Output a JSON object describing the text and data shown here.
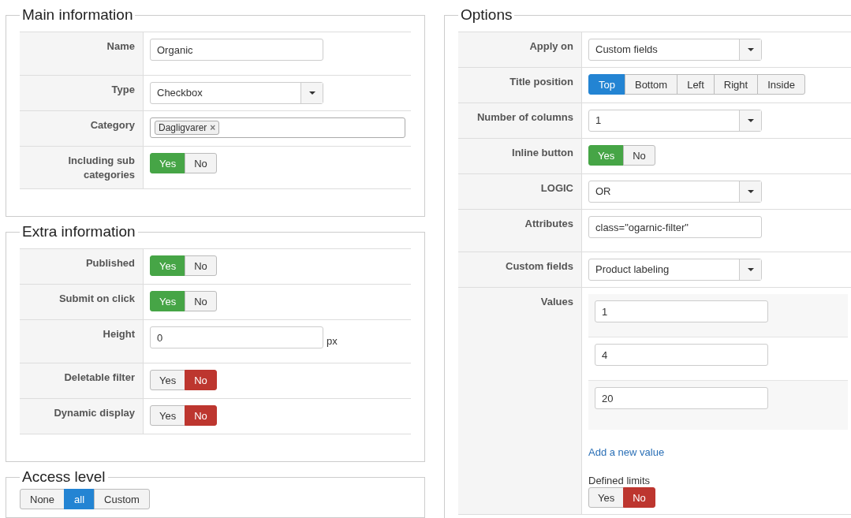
{
  "columns": [
    {
      "sections": [
        {
          "title": "Main information",
          "fields": [
            {
              "label": "Name",
              "kind": "text",
              "value": "Organic"
            },
            {
              "label": "Type",
              "kind": "select",
              "value": "Checkbox"
            },
            {
              "label": "Category",
              "kind": "tags",
              "tags": [
                {
                  "label": "Dagligvarer",
                  "remove": "×"
                }
              ]
            },
            {
              "label": "Including sub categories",
              "kind": "toggle",
              "options": [
                {
                  "label": "Yes",
                  "selected": true
                },
                {
                  "label": "No",
                  "selected": false
                }
              ]
            }
          ]
        },
        {
          "title": "Extra information",
          "fields": [
            {
              "label": "Published",
              "kind": "toggle",
              "options": [
                {
                  "label": "Yes",
                  "selected": true
                },
                {
                  "label": "No",
                  "selected": false
                }
              ]
            },
            {
              "label": "Submit on click",
              "kind": "toggle",
              "options": [
                {
                  "label": "Yes",
                  "selected": true
                },
                {
                  "label": "No",
                  "selected": false
                }
              ]
            },
            {
              "label": "Height",
              "kind": "text",
              "value": "0",
              "unit": "px"
            },
            {
              "label": "Deletable filter",
              "kind": "toggle",
              "options": [
                {
                  "label": "Yes",
                  "selected": false
                },
                {
                  "label": "No",
                  "selected": true
                }
              ]
            },
            {
              "label": "Dynamic display",
              "kind": "toggle",
              "options": [
                {
                  "label": "Yes",
                  "selected": false
                },
                {
                  "label": "No",
                  "selected": true
                }
              ]
            }
          ]
        },
        {
          "title": "Access level",
          "group": {
            "kind": "segmented",
            "options": [
              {
                "label": "None",
                "selected": false
              },
              {
                "label": "all",
                "selected": true
              },
              {
                "label": "Custom",
                "selected": false
              }
            ]
          }
        }
      ]
    },
    {
      "sections": [
        {
          "title": "Options",
          "fields": [
            {
              "label": "Apply on",
              "kind": "select",
              "value": "Custom fields"
            },
            {
              "label": "Title position",
              "kind": "segmented",
              "options": [
                {
                  "label": "Top",
                  "selected": true
                },
                {
                  "label": "Bottom",
                  "selected": false
                },
                {
                  "label": "Left",
                  "selected": false
                },
                {
                  "label": "Right",
                  "selected": false
                },
                {
                  "label": "Inside",
                  "selected": false
                }
              ]
            },
            {
              "label": "Number of columns",
              "kind": "select",
              "value": "1"
            },
            {
              "label": "Inline button",
              "kind": "toggle",
              "options": [
                {
                  "label": "Yes",
                  "selected": true
                },
                {
                  "label": "No",
                  "selected": false
                }
              ]
            },
            {
              "label": "LOGIC",
              "kind": "select",
              "value": "OR"
            },
            {
              "label": "Attributes",
              "kind": "text",
              "value": "class=\"ogarnic-filter\""
            },
            {
              "label": "Custom fields",
              "kind": "select",
              "value": "Product labeling"
            },
            {
              "label": "Values",
              "kind": "values",
              "values": [
                "1",
                "4",
                "20"
              ],
              "link": "Add a new value",
              "sublabel": "Defined limits",
              "options": [
                {
                  "label": "Yes",
                  "selected": false
                },
                {
                  "label": "No",
                  "selected": true
                }
              ]
            }
          ]
        }
      ]
    }
  ]
}
